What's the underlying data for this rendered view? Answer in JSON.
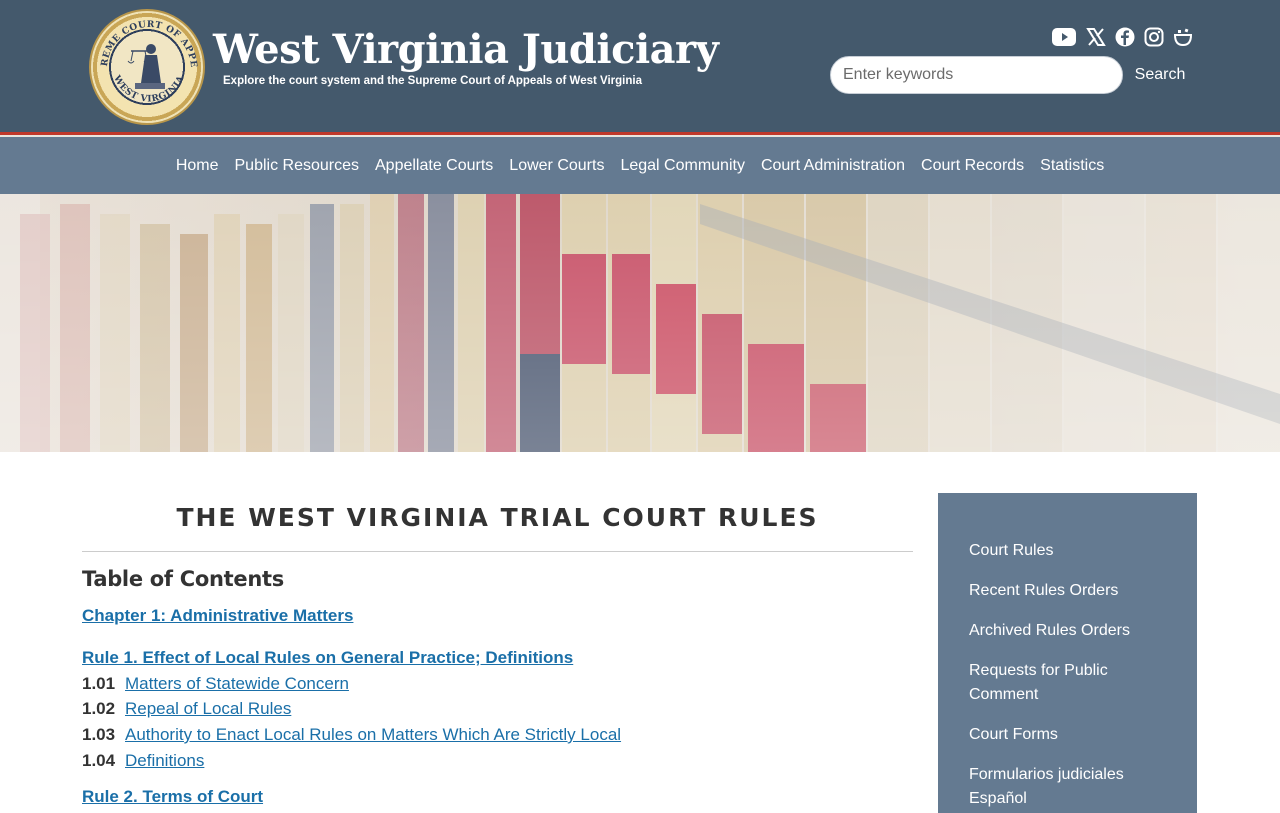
{
  "header": {
    "title": "West Virginia Judiciary",
    "tagline": "Explore the court system and the Supreme Court of Appeals of West Virginia",
    "seal_text_top": "SUPREME COURT OF APPEALS",
    "seal_text_bottom": "WEST VIRGINIA",
    "social_icons": [
      "youtube-icon",
      "x-icon",
      "facebook-icon",
      "instagram-icon",
      "smugmug-icon"
    ],
    "search": {
      "placeholder": "Enter keywords",
      "value": "",
      "button_label": "Search"
    }
  },
  "nav": {
    "items": [
      "Home",
      "Public Resources",
      "Appellate Courts",
      "Lower Courts",
      "Legal Community",
      "Court Administration",
      "Court Records",
      "Statistics"
    ]
  },
  "main": {
    "title": "THE WEST VIRGINIA TRIAL COURT RULES",
    "toc_title": "Table of Contents",
    "chapter_1": "Chapter 1: Administrative Matters",
    "rule_1": "Rule 1.  Effect of Local Rules on General Practice; Definitions",
    "items": [
      {
        "num": "1.01",
        "label": "Matters of Statewide Concern"
      },
      {
        "num": "1.02",
        "label": "Repeal of Local Rules"
      },
      {
        "num": "1.03",
        "label": "Authority to Enact Local Rules on Matters Which Are Strictly Local"
      },
      {
        "num": "1.04",
        "label": "Definitions"
      }
    ],
    "rule_2": "Rule 2.  Terms of Court"
  },
  "sidebar": {
    "links": [
      "Court Rules",
      "Recent Rules Orders",
      "Archived Rules Orders",
      "Requests for Public Comment",
      "Court Forms",
      "Formularios judiciales Español"
    ]
  },
  "colors": {
    "header_bg": "#44596c",
    "nav_bg": "#647a91",
    "accent_red": "#c0392b",
    "link": "#1a6fa8"
  }
}
